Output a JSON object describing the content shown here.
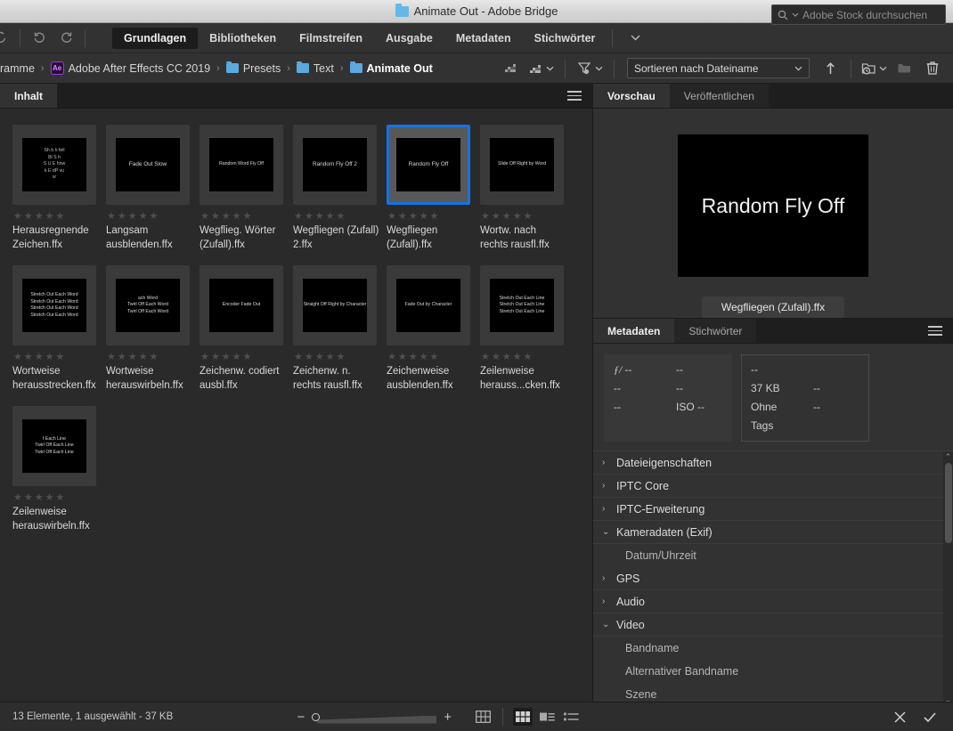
{
  "window": {
    "title": "Animate Out - Adobe Bridge",
    "folder_icon": "folder-icon"
  },
  "toolbar": {
    "back_icon": "back-arrow-icon",
    "undo_icon": "rotate-left-icon",
    "redo_icon": "rotate-right-icon",
    "workspace_tabs": [
      {
        "label": "Grundlagen",
        "active": true
      },
      {
        "label": "Bibliotheken",
        "active": false
      },
      {
        "label": "Filmstreifen",
        "active": false
      },
      {
        "label": "Ausgabe",
        "active": false
      },
      {
        "label": "Metadaten",
        "active": false
      },
      {
        "label": "Stichwörter",
        "active": false
      }
    ],
    "overflow_caret": "chevron-down-icon",
    "search": {
      "placeholder": "Adobe Stock durchsuchen",
      "icon": "search-icon",
      "caret": "chevron-down-icon"
    }
  },
  "pathbar": {
    "crumbs": [
      {
        "label": "ramme",
        "icon": "none",
        "bold": false
      },
      {
        "label": "Adobe After Effects CC 2019",
        "icon": "ae-icon",
        "bold": false
      },
      {
        "label": "Presets",
        "icon": "folder-icon",
        "bold": false
      },
      {
        "label": "Text",
        "icon": "folder-icon",
        "bold": false
      },
      {
        "label": "Animate Out",
        "icon": "folder-icon",
        "bold": true
      }
    ],
    "separator": "›",
    "tools": {
      "rating_filter_icon": "rating-filter-icon",
      "rating_filter_menu_icon": "rating-filter-menu-icon",
      "filter_icon": "filter-funnel-icon",
      "sort_label": "Sortieren nach Dateiname",
      "sort_caret": "chevron-down-icon",
      "ascending_icon": "arrow-up-icon",
      "new_folder_recent_icon": "recent-folder-icon",
      "new_folder_icon": "new-folder-icon",
      "delete_icon": "trash-icon"
    }
  },
  "content_panel": {
    "tabs": [
      {
        "label": "Inhalt",
        "active": true
      }
    ],
    "menu_icon": "panel-menu-icon",
    "items": [
      {
        "name": "Herausregnende Zeichen.ffx",
        "thumb_text": "Sh b h fell\nBl S h\nS U E hnw\nk E dP vu\nxr",
        "thumb_style": "scatter",
        "rating": 0,
        "selected": false
      },
      {
        "name": "Langsam ausblenden.ffx",
        "thumb_text": "Fade Out Slow",
        "thumb_style": "big",
        "rating": 0,
        "selected": false
      },
      {
        "name": "Wegflieg. Wörter (Zufall).ffx",
        "thumb_text": "Random Word Fly Off",
        "thumb_style": "normal",
        "rating": 0,
        "selected": false
      },
      {
        "name": "Wegfliegen (Zufall) 2.ffx",
        "thumb_text": "Random Fly Off 2",
        "thumb_style": "big",
        "rating": 0,
        "selected": false
      },
      {
        "name": "Wegfliegen (Zufall).ffx",
        "thumb_text": "Random Fly Off",
        "thumb_style": "big",
        "rating": 0,
        "selected": true
      },
      {
        "name": "Wortw. nach rechts rausfl.ffx",
        "thumb_text": "Slide Off Right by Word",
        "thumb_style": "normal",
        "rating": 0,
        "selected": false
      },
      {
        "name": "Wortweise herausstrecken.ffx",
        "thumb_text": "Stretch Out Each Word\nStretch Out Each Word\nStretch Out Each Word\nStretch Out Each Word",
        "thumb_style": "normal",
        "rating": 0,
        "selected": false
      },
      {
        "name": "Wortweise herauswirbeln.ffx",
        "thumb_text": "ach Word\nTwirl Off Each Word\nTwirl Off Each Word",
        "thumb_style": "normal",
        "rating": 0,
        "selected": false
      },
      {
        "name": "Zeichenw. codiert ausbl.ffx",
        "thumb_text": "Encoder Fade Out",
        "thumb_style": "normal",
        "rating": 0,
        "selected": false
      },
      {
        "name": "Zeichenw. n. rechts rausfl.ffx",
        "thumb_text": "Straight Off Right by Character",
        "thumb_style": "normal",
        "rating": 0,
        "selected": false
      },
      {
        "name": "Zeichenweise ausblenden.ffx",
        "thumb_text": "Fade Out by Character",
        "thumb_style": "normal",
        "rating": 0,
        "selected": false
      },
      {
        "name": "Zeilenweise herauss...cken.ffx",
        "thumb_text": "Stretch Out Each Line\nStretch Out Each Line\nStretch Out Each Line",
        "thumb_style": "normal",
        "rating": 0,
        "selected": false
      },
      {
        "name": "Zeilenweise herauswirbeln.ffx",
        "thumb_text": "f Each Line\nTwirl Off Each Line\nTwirl Off Each Line",
        "thumb_style": "normal",
        "rating": 0,
        "selected": false
      }
    ]
  },
  "preview_panel": {
    "tabs": [
      {
        "label": "Vorschau",
        "active": true
      },
      {
        "label": "Veröffentlichen",
        "active": false
      }
    ],
    "image_text": "Random Fly Off",
    "caption": "Wegfliegen (Zufall).ffx"
  },
  "metadata_panel": {
    "tabs": [
      {
        "label": "Metadaten",
        "active": true
      },
      {
        "label": "Stichwörter",
        "active": false
      }
    ],
    "menu_icon": "panel-menu-icon",
    "chips_left": [
      {
        "a": "ƒ/ --",
        "b": "--"
      },
      {
        "a": "--",
        "b": "--"
      },
      {
        "a": "--",
        "b": "ISO --"
      }
    ],
    "chips_right": [
      {
        "a": "--",
        "b": ""
      },
      {
        "a": "37 KB",
        "b": "--"
      },
      {
        "a": "Ohne Tags",
        "b": "--"
      }
    ],
    "rows": [
      {
        "label": "Dateieigenschaften",
        "state": "collapsed",
        "level": 0
      },
      {
        "label": "IPTC Core",
        "state": "collapsed",
        "level": 0
      },
      {
        "label": "IPTC-Erweiterung",
        "state": "collapsed",
        "level": 0
      },
      {
        "label": "Kameradaten (Exif)",
        "state": "expanded",
        "level": 0
      },
      {
        "label": "Datum/Uhrzeit",
        "state": "leaf",
        "level": 1
      },
      {
        "label": "GPS",
        "state": "collapsed",
        "level": 0
      },
      {
        "label": "Audio",
        "state": "collapsed",
        "level": 0
      },
      {
        "label": "Video",
        "state": "expanded",
        "level": 0
      },
      {
        "label": "Bandname",
        "state": "leaf",
        "level": 1
      },
      {
        "label": "Alternativer Bandname",
        "state": "leaf",
        "level": 1
      },
      {
        "label": "Szene",
        "state": "leaf",
        "level": 1
      }
    ]
  },
  "statusbar": {
    "status": "13 Elemente, 1 ausgewählt - 37 KB",
    "zoom_minus": "−",
    "zoom_plus": "+",
    "view_modes": [
      {
        "name": "grid-view-icon",
        "active": false
      },
      {
        "name": "thumbnail-view-icon",
        "active": true
      },
      {
        "name": "details-view-icon",
        "active": false
      },
      {
        "name": "list-view-icon",
        "active": false
      }
    ],
    "cancel_icon": "close-icon",
    "confirm_icon": "check-icon"
  },
  "colors": {
    "accent": "#1473e6",
    "panel_bg": "#323232",
    "content_bg": "#2a2a2a",
    "titlebar": "#d6d6d6"
  }
}
